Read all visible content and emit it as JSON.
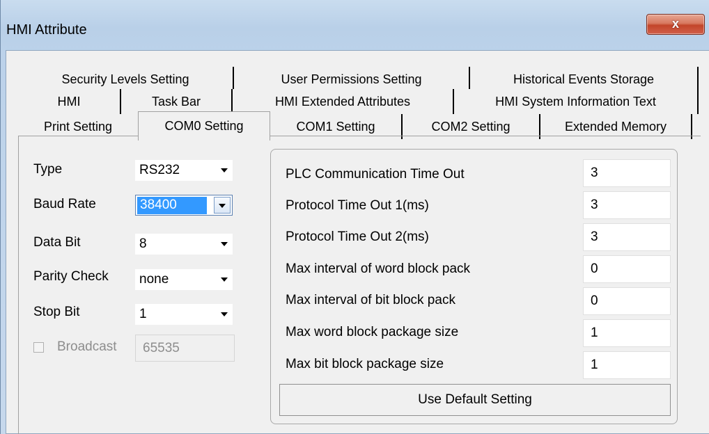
{
  "window": {
    "title": "HMI Attribute",
    "close_glyph": "x"
  },
  "tabs": {
    "row1": [
      "Security Levels Setting",
      "User Permissions Setting",
      "Historical Events Storage"
    ],
    "row2": [
      "HMI",
      "Task Bar",
      "HMI Extended Attributes",
      "HMI System Information Text"
    ],
    "row3": [
      "Print Setting",
      "COM0 Setting",
      "COM1 Setting",
      "COM2 Setting",
      "Extended Memory"
    ],
    "selected": "COM0 Setting"
  },
  "left_form": {
    "type": {
      "label": "Type",
      "value": "RS232"
    },
    "baud_rate": {
      "label": "Baud Rate",
      "value": "38400"
    },
    "data_bit": {
      "label": "Data Bit",
      "value": "8"
    },
    "parity_check": {
      "label": "Parity Check",
      "value": "none"
    },
    "stop_bit": {
      "label": "Stop Bit",
      "value": "1"
    },
    "broadcast": {
      "label": "Broadcast",
      "value": "65535",
      "checked": false
    }
  },
  "params": [
    {
      "label": "PLC Communication Time Out",
      "value": "3"
    },
    {
      "label": "Protocol Time Out 1(ms)",
      "value": "3"
    },
    {
      "label": "Protocol Time Out 2(ms)",
      "value": "3"
    },
    {
      "label": "Max interval of word block pack",
      "value": "0"
    },
    {
      "label": "Max interval of bit block pack",
      "value": "0"
    },
    {
      "label": "Max word block package size",
      "value": "1"
    },
    {
      "label": "Max bit block package size",
      "value": "1"
    }
  ],
  "default_button": "Use Default Setting",
  "colors": {
    "selection": "#3399ff",
    "close_button": "#c2452a"
  }
}
